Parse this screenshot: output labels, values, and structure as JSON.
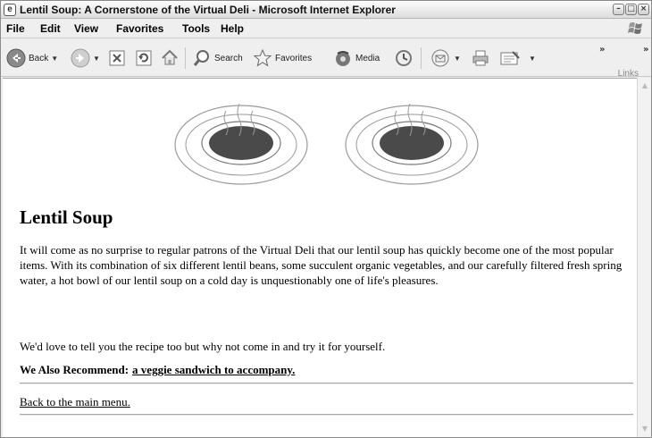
{
  "window": {
    "title": "Lentil Soup: A Cornerstone of the Virtual Deli - Microsoft Internet Explorer",
    "icon": "ie-page-icon",
    "controls": [
      "minimize",
      "maximize",
      "close"
    ]
  },
  "menubar": {
    "items": [
      "File",
      "Edit",
      "View",
      "Favorites",
      "Tools",
      "Help"
    ]
  },
  "toolbar": {
    "back_label": "Back",
    "search_label": "Search",
    "favorites_label": "Favorites",
    "media_label": "Media",
    "links_label": "Links",
    "chevron": "»"
  },
  "page": {
    "heading": "Lentil Soup",
    "paragraph": "It will come as no surprise to regular patrons of the Virtual Deli that our lentil soup has quickly become one of the most popular items. With its combination of six different lentil beans, some succulent organic vegetables, and our carefully filtered fresh spring water, a hot bowl of our lentil soup on a cold day is unquestionably one of life's pleasures.",
    "paragraph2": "We'd love to tell you the recipe too but why not come in and try it for yourself.",
    "recommend_label": "We Also Recommend:",
    "recommend_link": "a veggie sandwich to accompany.",
    "back_link": "Back to the main menu.",
    "images": [
      "soup-bowl-image",
      "soup-bowl-image"
    ]
  },
  "colors": {
    "soup": "#4a4a4a",
    "bowl_outline": "#8c8c8c",
    "window_chrome": "#ececec",
    "page_background": "#ffffff"
  }
}
